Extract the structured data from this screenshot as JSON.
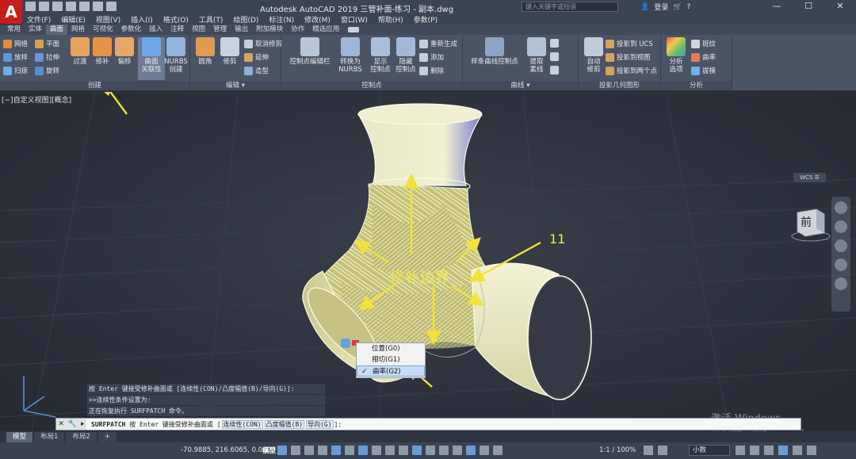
{
  "app": {
    "logo": "A",
    "title": "Autodesk AutoCAD 2019   三管补面-练习 - 副本.dwg",
    "search_placeholder": "键入关键字或短语",
    "login_label": "登录",
    "window_controls": [
      "—",
      "☐",
      "✕"
    ]
  },
  "menu": [
    "文件(F)",
    "编辑(E)",
    "视图(V)",
    "插入(I)",
    "格式(O)",
    "工具(T)",
    "绘图(D)",
    "标注(N)",
    "修改(M)",
    "窗口(W)",
    "帮助(H)",
    "参数(P)"
  ],
  "ribbon_tabs": [
    {
      "label": "常用",
      "active": false
    },
    {
      "label": "实体",
      "active": false
    },
    {
      "label": "曲面",
      "active": true
    },
    {
      "label": "网格",
      "active": false
    },
    {
      "label": "可视化",
      "active": false
    },
    {
      "label": "参数化",
      "active": false
    },
    {
      "label": "插入",
      "active": false
    },
    {
      "label": "注释",
      "active": false
    },
    {
      "label": "视图",
      "active": false
    },
    {
      "label": "管理",
      "active": false
    },
    {
      "label": "输出",
      "active": false
    },
    {
      "label": "附加模块",
      "active": false
    },
    {
      "label": "协作",
      "active": false
    },
    {
      "label": "精选应用",
      "active": false
    }
  ],
  "ribbon": {
    "create": {
      "title": "创建",
      "small": [
        "网络",
        "放样",
        "扫掠",
        "平面",
        "拉伸",
        "旋转"
      ],
      "big": [
        "过渡",
        "修补",
        "偏移",
        "曲面\n关联性",
        "NURBS\n创建"
      ]
    },
    "edit": {
      "title": "编辑",
      "big": [
        "圆角",
        "修剪"
      ],
      "small": [
        "取消修剪",
        "延伸",
        "造型"
      ]
    },
    "cv": {
      "title": "控制点",
      "big": [
        "控制点编辑栏",
        "转换为\nNURBS",
        "显示\n控制点",
        "隐藏\n控制点"
      ],
      "small": [
        "重新生成",
        "添加",
        "删除"
      ]
    },
    "curve": {
      "title": "曲线",
      "big": [
        "样条曲线控制点",
        "提取\n素线"
      ]
    },
    "project": {
      "title": "投影几何图形",
      "big": [
        "自动\n修剪"
      ],
      "small": [
        "投影到 UCS",
        "投影到视图",
        "投影到两个点"
      ]
    },
    "analysis": {
      "title": "分析",
      "big": [
        "分析\n选项"
      ],
      "small": [
        "斑纹",
        "曲率",
        "拔模"
      ]
    }
  },
  "viewport": {
    "label": "[−]自定义视图][概念]",
    "annotation": "修补边界",
    "number_label": "11",
    "viewcube_face": "前",
    "wcs_label": "WCS ☰",
    "colors": {
      "surface": "#efeeb6",
      "patch_bg": "#d2cf80",
      "arrow": "#f2e23a",
      "pipe_shade": "#7b7fd0"
    }
  },
  "context_menu": {
    "items": [
      {
        "label": "位置(G0)",
        "checked": false
      },
      {
        "label": "相切(G1)",
        "checked": false
      },
      {
        "label": "曲率(G2)",
        "checked": true
      }
    ]
  },
  "command_history": [
    "按 Enter 键接受修补曲面或 [连续性(CON)/凸度幅值(B)/导向(G)]:",
    ">>连续性条件设置为:",
    "正在恢复执行 SURFPATCH 命令。"
  ],
  "command_line": {
    "cmd": "SURFPATCH",
    "prompt": "按 Enter 键接受修补曲面或 [",
    "options": [
      "连续性(CON)",
      "凸度幅值(B)",
      "导向(G)"
    ],
    "suffix": "]:"
  },
  "layout_tabs": [
    {
      "label": "模型",
      "active": true
    },
    {
      "label": "布局1",
      "active": false
    },
    {
      "label": "布局2",
      "active": false
    },
    {
      "label": "+",
      "active": false
    }
  ],
  "status": {
    "coords": "-70.9885, 216.6065, 0.0000",
    "model": "模型",
    "zoom": "1:1 / 100%",
    "units": "小数"
  },
  "watermark": {
    "line1": "激活 Windows",
    "line2": "转到\"设置\"以激活 Windows。"
  }
}
